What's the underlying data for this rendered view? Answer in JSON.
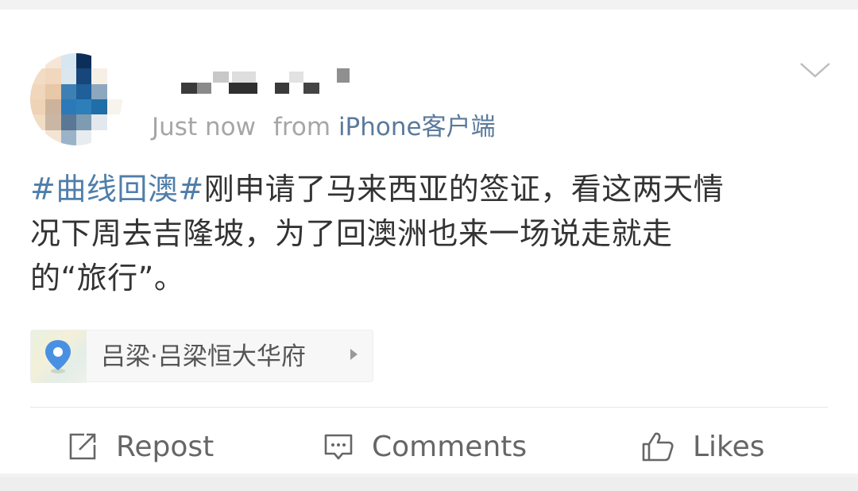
{
  "post": {
    "author_name": "",
    "timestamp": "Just now",
    "source_prefix": "from",
    "source": "iPhone客户端",
    "text_topic": "#曲线回澳#",
    "text_line1": "刚申请了马来西亚的签证，看这两天情",
    "text_line2": "况下周去吉隆坡，为了回澳洲也来一场说走就走",
    "text_line3": "的“旅行”。",
    "location": "吕梁·吕梁恒大华府"
  },
  "actions": {
    "repost_label": "Repost",
    "comments_label": "Comments",
    "likes_label": "Likes"
  },
  "icons": {
    "menu": "chevron-down-icon",
    "location": "location-pin-icon",
    "repost": "repost-icon",
    "comments": "comment-icon",
    "likes": "thumbs-up-icon"
  },
  "colors": {
    "topic": "#4f7eaa",
    "source": "#5a7a9b",
    "meta": "#a6a6a6",
    "text": "#333333",
    "action": "#666666",
    "pin": "#4a90e2"
  }
}
